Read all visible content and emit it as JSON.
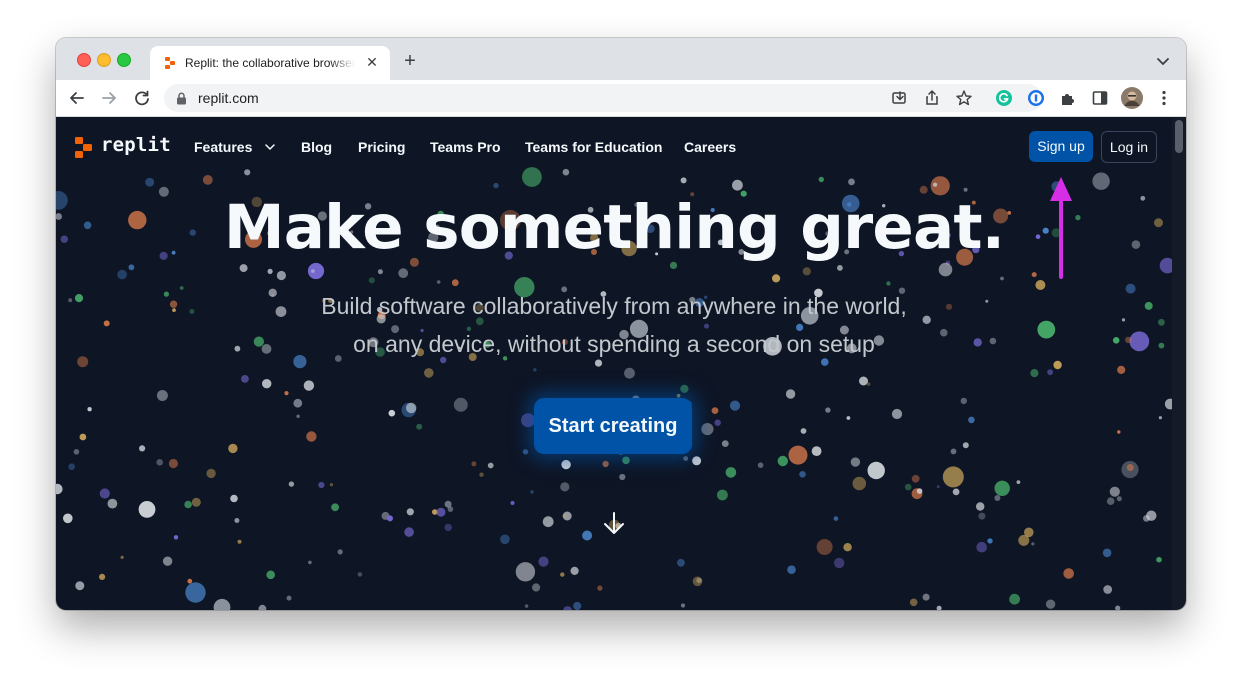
{
  "browser": {
    "tab_title": "Replit: the collaborative browser based IDE",
    "tab_close": "✕",
    "new_tab": "+",
    "url": "replit.com",
    "icons": [
      "back-icon",
      "forward-icon",
      "reload-icon",
      "lock-icon",
      "install-icon",
      "share-icon",
      "bookmark-star-icon",
      "grammarly-icon",
      "onepassword-icon",
      "extensions-icon",
      "side-panel-icon",
      "profile-avatar",
      "menu-icon"
    ]
  },
  "site": {
    "logo_text": "replit",
    "nav": {
      "features": "Features",
      "blog": "Blog",
      "pricing": "Pricing",
      "teams_pro": "Teams Pro",
      "teams_edu": "Teams for Education",
      "careers": "Careers"
    },
    "signup": "Sign up",
    "login": "Log in",
    "headline": "Make something great.",
    "sub_line1": "Build software collaboratively from anywhere in the world,",
    "sub_line2": "on any device, without spending a second on setup",
    "cta": "Start creating"
  },
  "colors": {
    "page_bg": "#0e1525",
    "brand_orange": "#f26207",
    "primary_blue": "#0053a6",
    "annotation_arrow": "#d62ee6"
  }
}
